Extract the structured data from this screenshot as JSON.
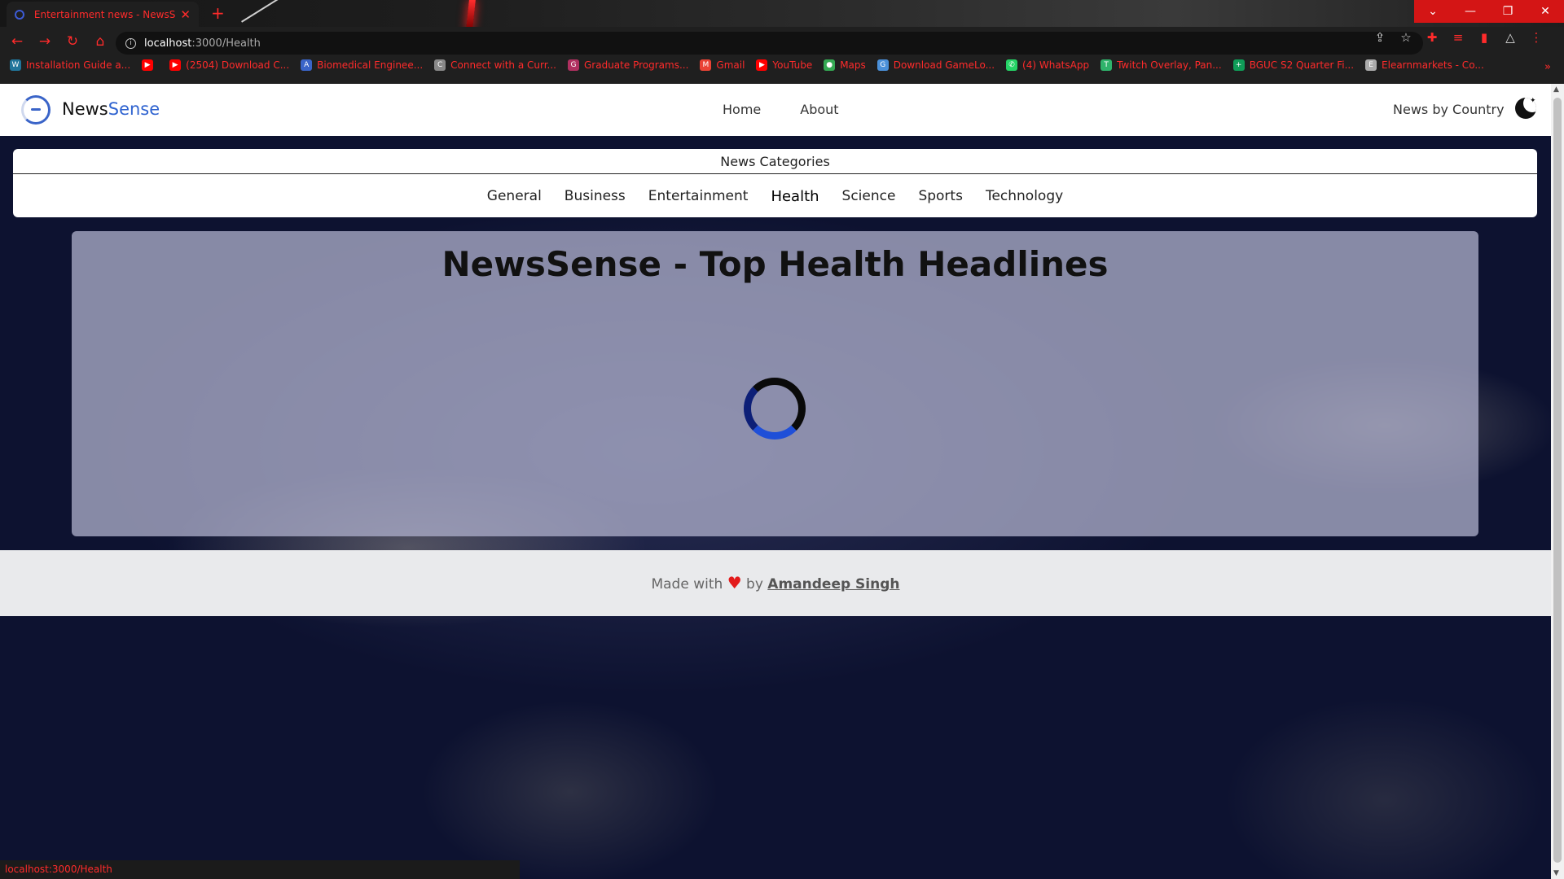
{
  "browser": {
    "tab_title": "Entertainment news - NewsSense",
    "tab_close": "✕",
    "new_tab": "+",
    "url_host": "localhost",
    "url_path": ":3000/Health",
    "window_controls": [
      "⌄",
      "—",
      "❐",
      "✕"
    ],
    "bookmarks": [
      {
        "label": "Installation Guide a...",
        "icon": "wordpress-icon",
        "color": "#21759b",
        "glyph": "W"
      },
      {
        "label": "",
        "icon": "youtube-icon",
        "color": "#ff0000",
        "glyph": "▶"
      },
      {
        "label": "(2504) Download C...",
        "icon": "youtube-icon",
        "color": "#ff0000",
        "glyph": "▶"
      },
      {
        "label": "Biomedical Enginee...",
        "icon": "logo-icon",
        "color": "#3a64c8",
        "glyph": "A"
      },
      {
        "label": "Connect with a Curr...",
        "icon": "site-icon",
        "color": "#888888",
        "glyph": "C"
      },
      {
        "label": "Graduate Programs...",
        "icon": "site-icon",
        "color": "#b03060",
        "glyph": "G"
      },
      {
        "label": "Gmail",
        "icon": "gmail-icon",
        "color": "#ea4335",
        "glyph": "M"
      },
      {
        "label": "YouTube",
        "icon": "youtube-icon",
        "color": "#ff0000",
        "glyph": "▶"
      },
      {
        "label": "Maps",
        "icon": "maps-icon",
        "color": "#34a853",
        "glyph": "●"
      },
      {
        "label": "Download GameLo...",
        "icon": "site-icon",
        "color": "#4a90d9",
        "glyph": "G"
      },
      {
        "label": "(4) WhatsApp",
        "icon": "whatsapp-icon",
        "color": "#25d366",
        "glyph": "✆"
      },
      {
        "label": "Twitch Overlay, Pan...",
        "icon": "site-icon",
        "color": "#2fb36b",
        "glyph": "T"
      },
      {
        "label": "BGUC S2 Quarter Fi...",
        "icon": "sheets-icon",
        "color": "#0f9d58",
        "glyph": "+"
      },
      {
        "label": "Elearnmarkets - Co...",
        "icon": "site-icon",
        "color": "#aaaaaa",
        "glyph": "E"
      }
    ],
    "bookmarks_more": "»",
    "status_url": "localhost:3000/Health"
  },
  "site": {
    "brand_main": "News",
    "brand_accent": "Sense",
    "nav": [
      "Home",
      "About"
    ],
    "country_label": "News by Country"
  },
  "categories": {
    "title": "News Categories",
    "items": [
      "General",
      "Business",
      "Entertainment",
      "Health",
      "Science",
      "Sports",
      "Technology"
    ],
    "active": "Health"
  },
  "main": {
    "headline": "NewsSense - Top Health Headlines"
  },
  "footer": {
    "made_with": "Made with",
    "heart": "♥",
    "by": "by",
    "author": "Amandeep Singh"
  },
  "colors": {
    "accent": "#2f63d0",
    "chrome_red": "#ff2b2b",
    "heart": "#e31b1b"
  }
}
